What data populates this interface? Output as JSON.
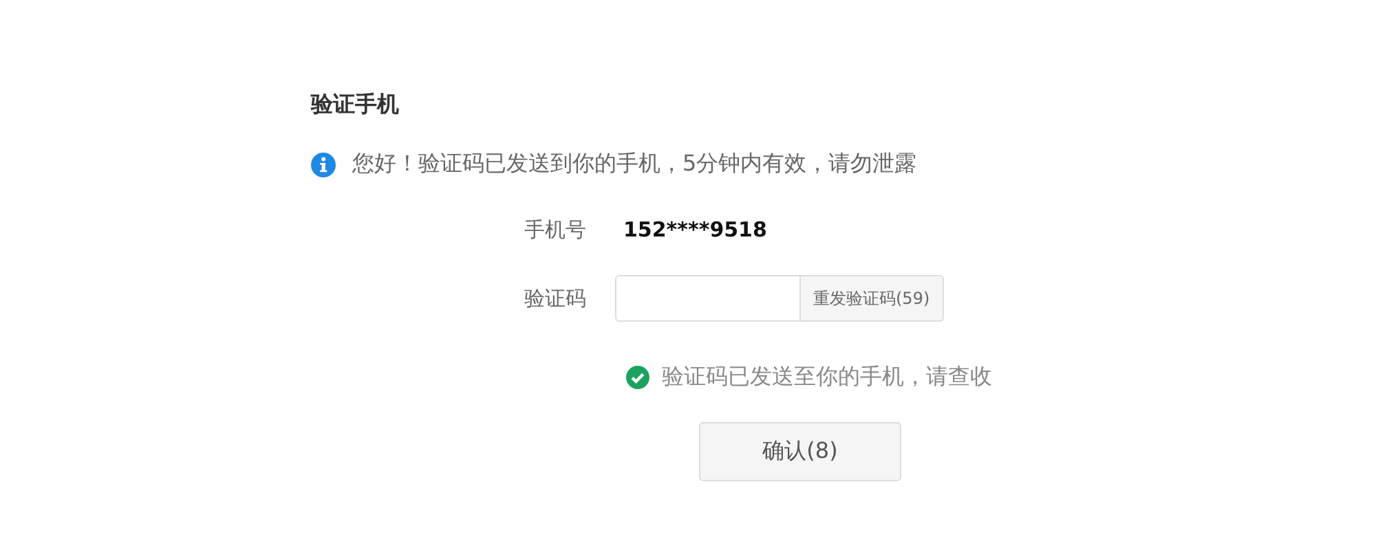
{
  "title": "验证手机",
  "notice": {
    "text": "您好！验证码已发送到你的手机，5分钟内有效，请勿泄露"
  },
  "fields": [
    {
      "kind": "text",
      "label": "手机号",
      "value": "152****9518"
    },
    {
      "kind": "input",
      "label": "验证码",
      "button": "重发验证码(59)"
    }
  ],
  "success": {
    "text": "验证码已发送至你的手机，请查收"
  },
  "confirm_button": "确认(8)"
}
